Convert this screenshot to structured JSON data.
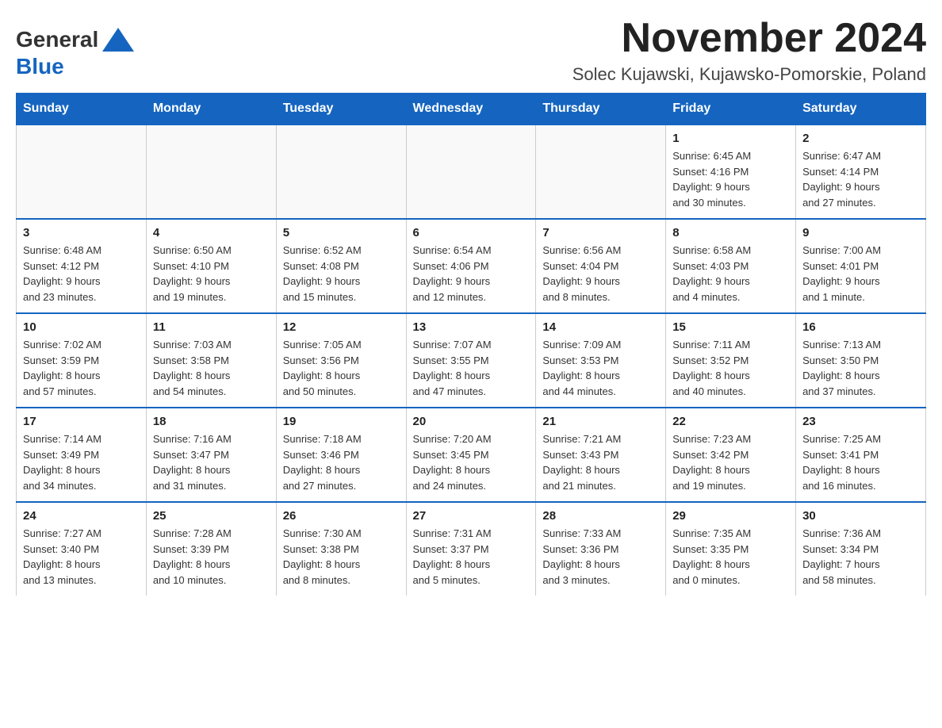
{
  "header": {
    "logo_general": "General",
    "logo_blue": "Blue",
    "title": "November 2024",
    "subtitle": "Solec Kujawski, Kujawsko-Pomorskie, Poland"
  },
  "days_of_week": [
    "Sunday",
    "Monday",
    "Tuesday",
    "Wednesday",
    "Thursday",
    "Friday",
    "Saturday"
  ],
  "weeks": [
    {
      "days": [
        {
          "number": "",
          "info": ""
        },
        {
          "number": "",
          "info": ""
        },
        {
          "number": "",
          "info": ""
        },
        {
          "number": "",
          "info": ""
        },
        {
          "number": "",
          "info": ""
        },
        {
          "number": "1",
          "info": "Sunrise: 6:45 AM\nSunset: 4:16 PM\nDaylight: 9 hours\nand 30 minutes."
        },
        {
          "number": "2",
          "info": "Sunrise: 6:47 AM\nSunset: 4:14 PM\nDaylight: 9 hours\nand 27 minutes."
        }
      ]
    },
    {
      "days": [
        {
          "number": "3",
          "info": "Sunrise: 6:48 AM\nSunset: 4:12 PM\nDaylight: 9 hours\nand 23 minutes."
        },
        {
          "number": "4",
          "info": "Sunrise: 6:50 AM\nSunset: 4:10 PM\nDaylight: 9 hours\nand 19 minutes."
        },
        {
          "number": "5",
          "info": "Sunrise: 6:52 AM\nSunset: 4:08 PM\nDaylight: 9 hours\nand 15 minutes."
        },
        {
          "number": "6",
          "info": "Sunrise: 6:54 AM\nSunset: 4:06 PM\nDaylight: 9 hours\nand 12 minutes."
        },
        {
          "number": "7",
          "info": "Sunrise: 6:56 AM\nSunset: 4:04 PM\nDaylight: 9 hours\nand 8 minutes."
        },
        {
          "number": "8",
          "info": "Sunrise: 6:58 AM\nSunset: 4:03 PM\nDaylight: 9 hours\nand 4 minutes."
        },
        {
          "number": "9",
          "info": "Sunrise: 7:00 AM\nSunset: 4:01 PM\nDaylight: 9 hours\nand 1 minute."
        }
      ]
    },
    {
      "days": [
        {
          "number": "10",
          "info": "Sunrise: 7:02 AM\nSunset: 3:59 PM\nDaylight: 8 hours\nand 57 minutes."
        },
        {
          "number": "11",
          "info": "Sunrise: 7:03 AM\nSunset: 3:58 PM\nDaylight: 8 hours\nand 54 minutes."
        },
        {
          "number": "12",
          "info": "Sunrise: 7:05 AM\nSunset: 3:56 PM\nDaylight: 8 hours\nand 50 minutes."
        },
        {
          "number": "13",
          "info": "Sunrise: 7:07 AM\nSunset: 3:55 PM\nDaylight: 8 hours\nand 47 minutes."
        },
        {
          "number": "14",
          "info": "Sunrise: 7:09 AM\nSunset: 3:53 PM\nDaylight: 8 hours\nand 44 minutes."
        },
        {
          "number": "15",
          "info": "Sunrise: 7:11 AM\nSunset: 3:52 PM\nDaylight: 8 hours\nand 40 minutes."
        },
        {
          "number": "16",
          "info": "Sunrise: 7:13 AM\nSunset: 3:50 PM\nDaylight: 8 hours\nand 37 minutes."
        }
      ]
    },
    {
      "days": [
        {
          "number": "17",
          "info": "Sunrise: 7:14 AM\nSunset: 3:49 PM\nDaylight: 8 hours\nand 34 minutes."
        },
        {
          "number": "18",
          "info": "Sunrise: 7:16 AM\nSunset: 3:47 PM\nDaylight: 8 hours\nand 31 minutes."
        },
        {
          "number": "19",
          "info": "Sunrise: 7:18 AM\nSunset: 3:46 PM\nDaylight: 8 hours\nand 27 minutes."
        },
        {
          "number": "20",
          "info": "Sunrise: 7:20 AM\nSunset: 3:45 PM\nDaylight: 8 hours\nand 24 minutes."
        },
        {
          "number": "21",
          "info": "Sunrise: 7:21 AM\nSunset: 3:43 PM\nDaylight: 8 hours\nand 21 minutes."
        },
        {
          "number": "22",
          "info": "Sunrise: 7:23 AM\nSunset: 3:42 PM\nDaylight: 8 hours\nand 19 minutes."
        },
        {
          "number": "23",
          "info": "Sunrise: 7:25 AM\nSunset: 3:41 PM\nDaylight: 8 hours\nand 16 minutes."
        }
      ]
    },
    {
      "days": [
        {
          "number": "24",
          "info": "Sunrise: 7:27 AM\nSunset: 3:40 PM\nDaylight: 8 hours\nand 13 minutes."
        },
        {
          "number": "25",
          "info": "Sunrise: 7:28 AM\nSunset: 3:39 PM\nDaylight: 8 hours\nand 10 minutes."
        },
        {
          "number": "26",
          "info": "Sunrise: 7:30 AM\nSunset: 3:38 PM\nDaylight: 8 hours\nand 8 minutes."
        },
        {
          "number": "27",
          "info": "Sunrise: 7:31 AM\nSunset: 3:37 PM\nDaylight: 8 hours\nand 5 minutes."
        },
        {
          "number": "28",
          "info": "Sunrise: 7:33 AM\nSunset: 3:36 PM\nDaylight: 8 hours\nand 3 minutes."
        },
        {
          "number": "29",
          "info": "Sunrise: 7:35 AM\nSunset: 3:35 PM\nDaylight: 8 hours\nand 0 minutes."
        },
        {
          "number": "30",
          "info": "Sunrise: 7:36 AM\nSunset: 3:34 PM\nDaylight: 7 hours\nand 58 minutes."
        }
      ]
    }
  ]
}
